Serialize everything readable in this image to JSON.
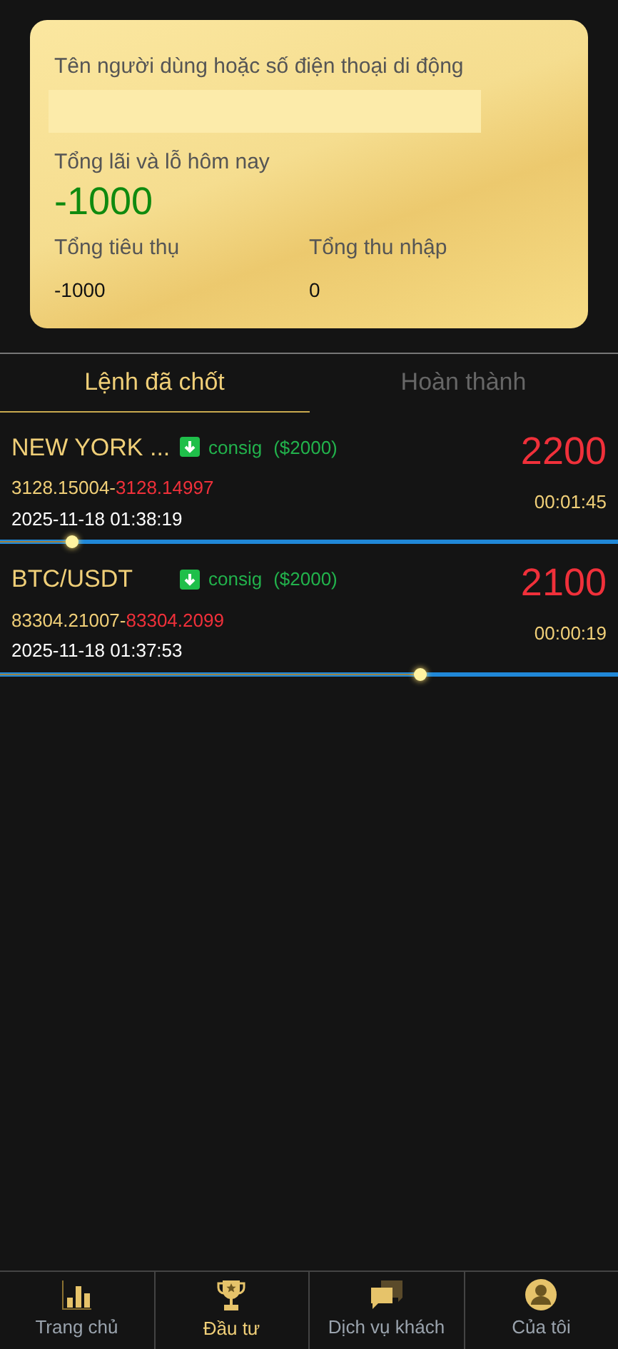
{
  "summary": {
    "user_label": "Tên người dùng hoặc số điện thoại di động",
    "pnl_label": "Tổng lãi và lỗ hôm nay",
    "pnl_value": "-1000",
    "spend_label": "Tổng tiêu thụ",
    "spend_value": "-1000",
    "income_label": "Tổng thu nhập",
    "income_value": "0"
  },
  "tabs": [
    {
      "label": "Lệnh đã chốt",
      "selected": true
    },
    {
      "label": "Hoàn thành",
      "selected": false
    }
  ],
  "orders": [
    {
      "name": "NEW YORK ...",
      "down": true,
      "type": "consig",
      "amount": "($2000)",
      "open_price": "3128.15004-",
      "close_price": "3128.14997",
      "time": "2025-11-18 01:38:19",
      "profit": "2200",
      "countdown": "00:01:45",
      "level": 0.115
    },
    {
      "name": "BTC/USDT",
      "down": true,
      "type": "consig",
      "amount": "($2000)",
      "open_price": "83304.21007-",
      "close_price": "83304.2099",
      "time": "2025-11-18 01:37:53",
      "profit": "2100",
      "countdown": "00:00:19",
      "level": 0.68
    }
  ],
  "nav": [
    {
      "kind": "chart",
      "label": "Trang chủ",
      "selected": false
    },
    {
      "kind": "trophy",
      "label": "Đầu tư",
      "selected": true
    },
    {
      "kind": "chat",
      "label": "Dịch vụ khách",
      "selected": false
    },
    {
      "kind": "user",
      "label": "Của tôi",
      "selected": false
    }
  ]
}
